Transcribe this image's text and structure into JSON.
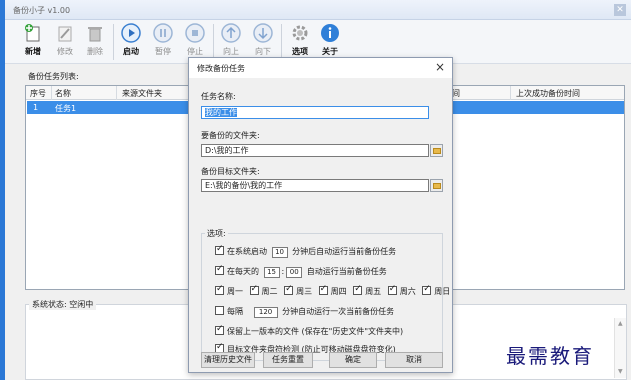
{
  "app": {
    "title": "备份小子 v1.00"
  },
  "toolbar": {
    "new": "新增",
    "edit": "修改",
    "delete": "删除",
    "start": "启动",
    "pause": "暂停",
    "stop": "停止",
    "up": "向上",
    "down": "向下",
    "options": "选项",
    "about": "关于"
  },
  "list": {
    "label": "备份任务列表:",
    "columns": [
      "序号",
      "名称",
      "来源文件夹",
      "间",
      "上次成功备份时间"
    ],
    "rows": [
      {
        "index": "1",
        "name": "任务1"
      }
    ]
  },
  "status": {
    "label": "系统状态: 空闲中"
  },
  "watermark": "最需教育",
  "dialog": {
    "title": "修改备份任务",
    "close": "×",
    "task_name_label": "任务名称:",
    "task_name_value": "我的工作",
    "source_label": "要备份的文件夹:",
    "source_value": "D:\\我的工作",
    "target_label": "备份目标文件夹:",
    "target_value": "E:\\我的备份\\我的工作",
    "options_label": "选项:",
    "opt_startup": {
      "prefix": "在系统启动",
      "minutes": "10",
      "suffix": "分钟后自动运行当前备份任务"
    },
    "opt_daily": {
      "prefix": "在每天的",
      "hour": "15",
      "colon": ":",
      "minute": "00",
      "suffix": "自动运行当前备份任务"
    },
    "weekdays": [
      "周一",
      "周二",
      "周三",
      "周四",
      "周五",
      "周六",
      "周日"
    ],
    "opt_interval": {
      "prefix": "每隔",
      "minutes": "120",
      "suffix": "分钟自动运行一次当前备份任务"
    },
    "opt_keep_history": "保留上一版本的文件 (保存在\"历史文件\"文件夹中)",
    "opt_drive_check": "目标文件夹盘符检测 (防止可移动磁盘盘符变化)",
    "buttons": {
      "clear_history": "清理历史文件",
      "reset": "任务重置",
      "ok": "确定",
      "cancel": "取消"
    }
  }
}
